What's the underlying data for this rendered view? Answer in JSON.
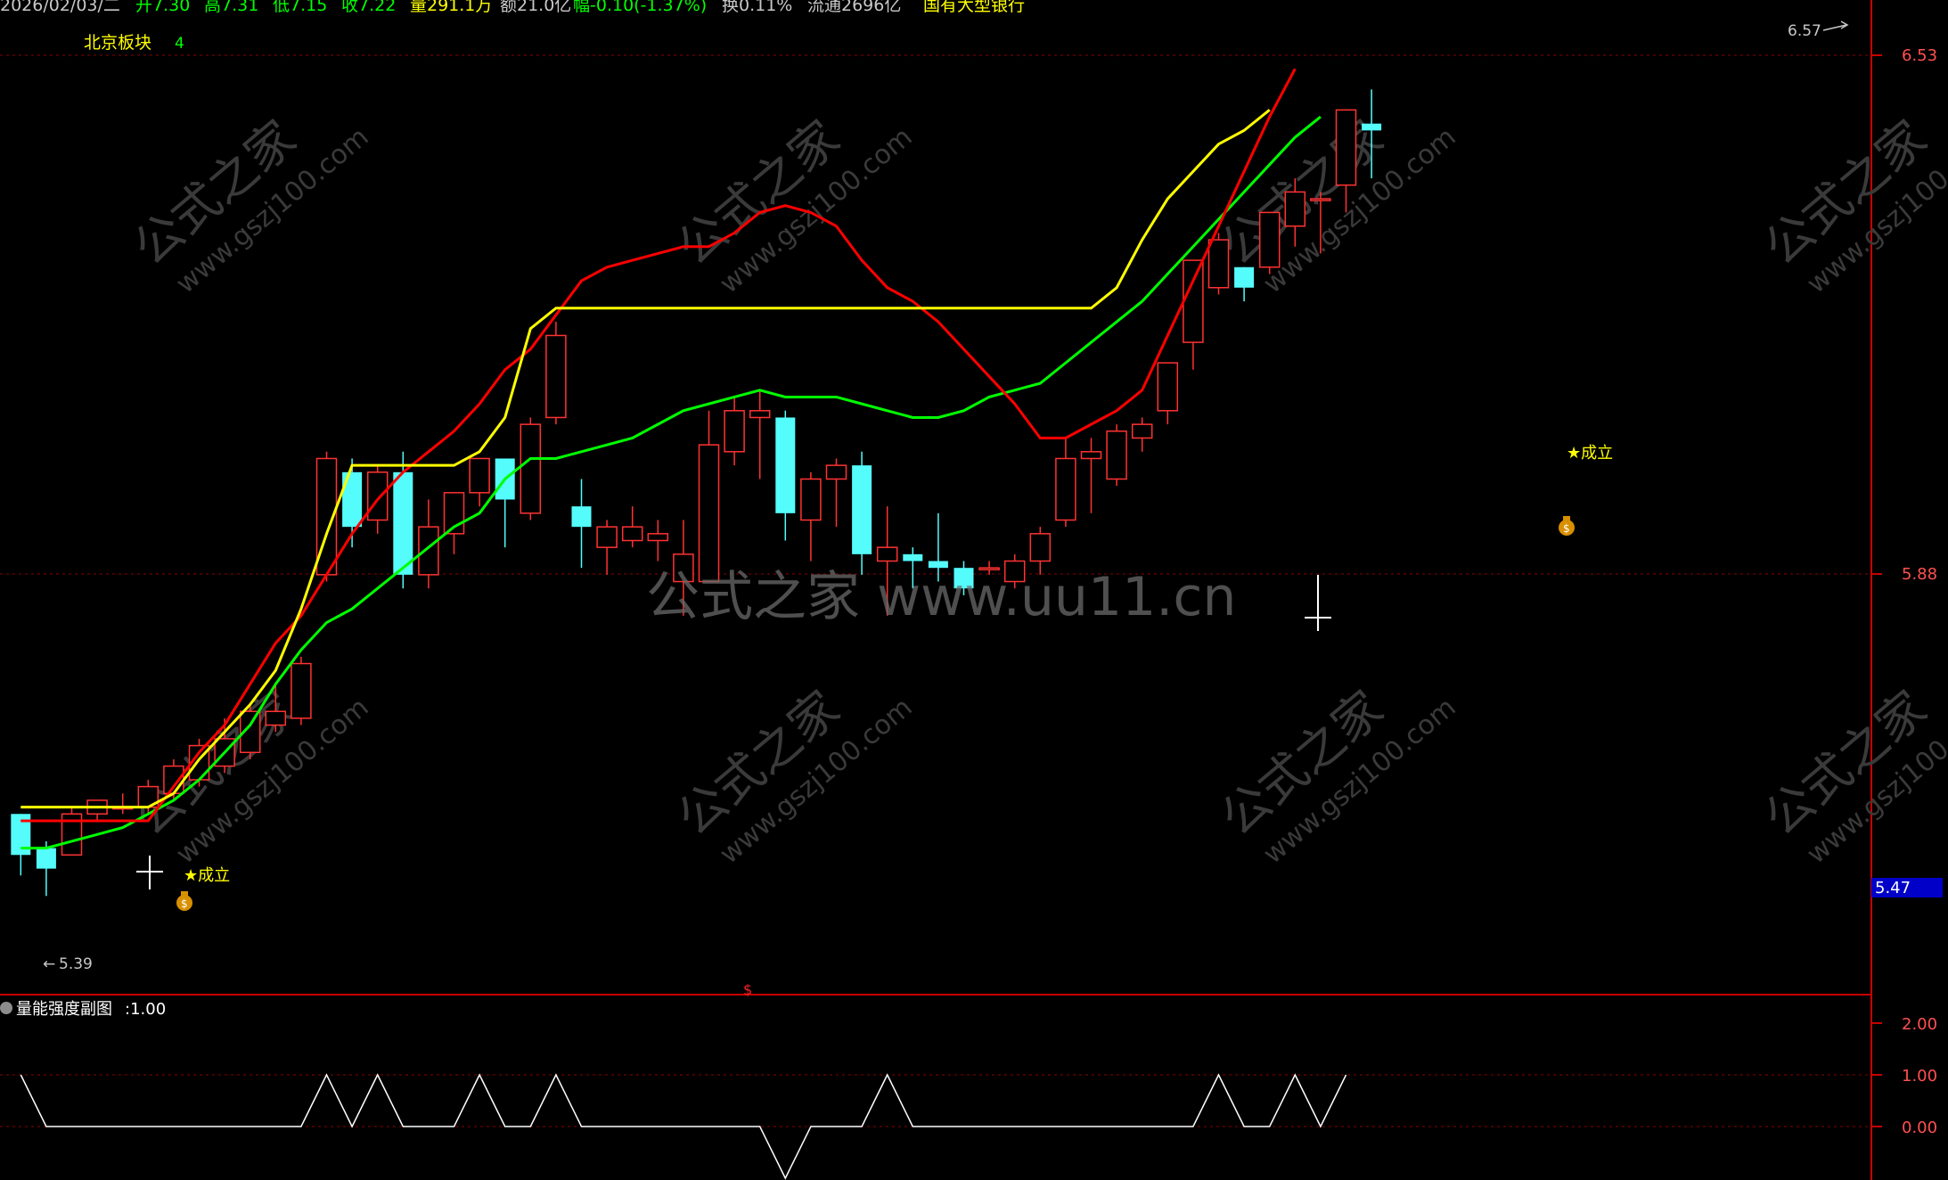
{
  "colors": {
    "background": "#000000",
    "up_candle": "#ff3232",
    "down_candle": "#54fcfc",
    "ma_red": "#ff0000",
    "ma_yellow": "#ffff00",
    "ma_green": "#00ff00",
    "grid_dotted": "#8b0000",
    "axis_red": "#c80000",
    "sub_line": "#ffffff",
    "latest_price_box": "#0000c8"
  },
  "header": {
    "date": "2026/02/03/二",
    "open": "开7.30",
    "high": "高7.31",
    "low": "低7.15",
    "close": "收7.22",
    "volume": "量291.1万",
    "amount": "额21.0亿",
    "change": "幅-0.10(-1.37%)",
    "turnover": "换0.11%",
    "float": "流通2696亿",
    "sector": "国有大型银行",
    "block_name": "北京板块",
    "block_count": "4"
  },
  "main_panel": {
    "price_axis_labels": [
      "6.53",
      "5.88"
    ],
    "latest_price_label": "5.47",
    "high_marker": "6.57",
    "low_marker": "5.39",
    "signals": [
      "★成立",
      "★成立"
    ],
    "bottom_marker": "$",
    "watermark_brand": "公式之家",
    "watermark_site": "www.gszj100.com",
    "watermark_center": "公式之家 www.uu11.cn"
  },
  "sub_panel": {
    "title": "量能强度副图",
    "value": ":1.00",
    "axis_labels": [
      "2.00",
      "1.00",
      "0.00"
    ]
  },
  "chart_data": {
    "type": "candlestick",
    "price_ylim": [
      5.26,
      6.62
    ],
    "candles": [
      {
        "o": 5.51,
        "h": 5.51,
        "l": 5.42,
        "c": 5.45
      },
      {
        "o": 5.46,
        "h": 5.47,
        "l": 5.39,
        "c": 5.43
      },
      {
        "o": 5.45,
        "h": 5.52,
        "l": 5.45,
        "c": 5.51
      },
      {
        "o": 5.51,
        "h": 5.53,
        "l": 5.5,
        "c": 5.53
      },
      {
        "o": 5.52,
        "h": 5.54,
        "l": 5.51,
        "c": 5.52
      },
      {
        "o": 5.52,
        "h": 5.56,
        "l": 5.51,
        "c": 5.55
      },
      {
        "o": 5.54,
        "h": 5.59,
        "l": 5.53,
        "c": 5.58
      },
      {
        "o": 5.56,
        "h": 5.62,
        "l": 5.55,
        "c": 5.61
      },
      {
        "o": 5.58,
        "h": 5.65,
        "l": 5.57,
        "c": 5.62
      },
      {
        "o": 5.6,
        "h": 5.67,
        "l": 5.59,
        "c": 5.66
      },
      {
        "o": 5.64,
        "h": 5.7,
        "l": 5.63,
        "c": 5.66
      },
      {
        "o": 5.65,
        "h": 5.74,
        "l": 5.64,
        "c": 5.73
      },
      {
        "o": 5.86,
        "h": 6.04,
        "l": 5.85,
        "c": 6.03
      },
      {
        "o": 6.01,
        "h": 6.03,
        "l": 5.9,
        "c": 5.93
      },
      {
        "o": 5.94,
        "h": 6.02,
        "l": 5.92,
        "c": 6.01
      },
      {
        "o": 6.01,
        "h": 6.04,
        "l": 5.84,
        "c": 5.86
      },
      {
        "o": 5.86,
        "h": 5.97,
        "l": 5.84,
        "c": 5.93
      },
      {
        "o": 5.92,
        "h": 5.98,
        "l": 5.89,
        "c": 5.98
      },
      {
        "o": 5.98,
        "h": 6.02,
        "l": 5.96,
        "c": 6.03
      },
      {
        "o": 6.03,
        "h": 6.03,
        "l": 5.9,
        "c": 5.97
      },
      {
        "o": 5.95,
        "h": 6.09,
        "l": 5.94,
        "c": 6.08
      },
      {
        "o": 6.09,
        "h": 6.23,
        "l": 6.08,
        "c": 6.21
      },
      {
        "o": 5.96,
        "h": 6.0,
        "l": 5.87,
        "c": 5.93
      },
      {
        "o": 5.9,
        "h": 5.94,
        "l": 5.86,
        "c": 5.93
      },
      {
        "o": 5.91,
        "h": 5.96,
        "l": 5.9,
        "c": 5.93
      },
      {
        "o": 5.91,
        "h": 5.94,
        "l": 5.88,
        "c": 5.92
      },
      {
        "o": 5.85,
        "h": 5.94,
        "l": 5.8,
        "c": 5.89
      },
      {
        "o": 5.85,
        "h": 6.1,
        "l": 5.85,
        "c": 6.05
      },
      {
        "o": 6.04,
        "h": 6.12,
        "l": 6.02,
        "c": 6.1
      },
      {
        "o": 6.09,
        "h": 6.13,
        "l": 6.0,
        "c": 6.1
      },
      {
        "o": 6.09,
        "h": 6.1,
        "l": 5.91,
        "c": 5.95
      },
      {
        "o": 5.94,
        "h": 6.01,
        "l": 5.88,
        "c": 6.0
      },
      {
        "o": 6.0,
        "h": 6.03,
        "l": 5.93,
        "c": 6.02
      },
      {
        "o": 6.02,
        "h": 6.04,
        "l": 5.86,
        "c": 5.89
      },
      {
        "o": 5.88,
        "h": 5.96,
        "l": 5.8,
        "c": 5.9
      },
      {
        "o": 5.89,
        "h": 5.9,
        "l": 5.84,
        "c": 5.88
      },
      {
        "o": 5.88,
        "h": 5.95,
        "l": 5.85,
        "c": 5.87
      },
      {
        "o": 5.87,
        "h": 5.88,
        "l": 5.83,
        "c": 5.84
      },
      {
        "o": 5.87,
        "h": 5.88,
        "l": 5.86,
        "c": 5.87
      },
      {
        "o": 5.85,
        "h": 5.89,
        "l": 5.84,
        "c": 5.88
      },
      {
        "o": 5.88,
        "h": 5.93,
        "l": 5.86,
        "c": 5.92
      },
      {
        "o": 5.94,
        "h": 6.06,
        "l": 5.93,
        "c": 6.03
      },
      {
        "o": 6.03,
        "h": 6.06,
        "l": 5.95,
        "c": 6.04
      },
      {
        "o": 6.0,
        "h": 6.08,
        "l": 5.99,
        "c": 6.07
      },
      {
        "o": 6.06,
        "h": 6.09,
        "l": 6.04,
        "c": 6.08
      },
      {
        "o": 6.1,
        "h": 6.17,
        "l": 6.08,
        "c": 6.17
      },
      {
        "o": 6.2,
        "h": 6.32,
        "l": 6.16,
        "c": 6.32
      },
      {
        "o": 6.28,
        "h": 6.36,
        "l": 6.27,
        "c": 6.35
      },
      {
        "o": 6.31,
        "h": 6.31,
        "l": 6.26,
        "c": 6.28
      },
      {
        "o": 6.31,
        "h": 6.39,
        "l": 6.3,
        "c": 6.39
      },
      {
        "o": 6.37,
        "h": 6.44,
        "l": 6.34,
        "c": 6.42
      },
      {
        "o": 6.41,
        "h": 6.42,
        "l": 6.33,
        "c": 6.41
      },
      {
        "o": 6.43,
        "h": 6.52,
        "l": 6.39,
        "c": 6.54
      },
      {
        "o": 6.52,
        "h": 6.57,
        "l": 6.44,
        "c": 6.51
      }
    ],
    "ma_red": [
      5.5,
      5.5,
      5.5,
      5.5,
      5.5,
      5.5,
      5.55,
      5.6,
      5.64,
      5.7,
      5.76,
      5.8,
      5.86,
      5.92,
      5.97,
      6.01,
      6.04,
      6.07,
      6.11,
      6.16,
      6.19,
      6.24,
      6.29,
      6.31,
      6.32,
      6.33,
      6.34,
      6.34,
      6.36,
      6.39,
      6.4,
      6.39,
      6.37,
      6.32,
      6.28,
      6.26,
      6.23,
      6.19,
      6.15,
      6.11,
      6.06,
      6.06,
      6.08,
      6.1,
      6.13,
      6.21,
      6.29,
      6.37,
      6.45,
      6.53,
      6.6
    ],
    "ma_yellow": [
      5.52,
      5.52,
      5.52,
      5.52,
      5.52,
      5.52,
      5.54,
      5.59,
      5.63,
      5.67,
      5.72,
      5.81,
      5.92,
      6.02,
      6.02,
      6.02,
      6.02,
      6.02,
      6.04,
      6.09,
      6.22,
      6.25,
      6.25,
      6.25,
      6.25,
      6.25,
      6.25,
      6.25,
      6.25,
      6.25,
      6.25,
      6.25,
      6.25,
      6.25,
      6.25,
      6.25,
      6.25,
      6.25,
      6.25,
      6.25,
      6.25,
      6.25,
      6.25,
      6.28,
      6.35,
      6.41,
      6.45,
      6.49,
      6.51,
      6.54
    ],
    "ma_green": [
      5.46,
      5.46,
      5.47,
      5.48,
      5.49,
      5.51,
      5.53,
      5.56,
      5.6,
      5.64,
      5.7,
      5.75,
      5.79,
      5.81,
      5.84,
      5.87,
      5.9,
      5.93,
      5.95,
      6.0,
      6.03,
      6.03,
      6.04,
      6.05,
      6.06,
      6.08,
      6.1,
      6.11,
      6.12,
      6.13,
      6.12,
      6.12,
      6.12,
      6.11,
      6.1,
      6.09,
      6.09,
      6.1,
      6.12,
      6.13,
      6.14,
      6.17,
      6.2,
      6.23,
      6.26,
      6.3,
      6.34,
      6.38,
      6.42,
      6.46,
      6.5,
      6.53
    ],
    "sub_series": [
      1,
      0,
      0,
      0,
      0,
      0,
      0,
      0,
      0,
      0,
      0,
      0,
      1,
      0,
      1,
      0,
      0,
      0,
      1,
      0,
      0,
      1,
      0,
      0,
      0,
      0,
      0,
      0,
      0,
      0,
      -1,
      0,
      0,
      0,
      1,
      0,
      0,
      0,
      0,
      0,
      0,
      0,
      0,
      0,
      0,
      0,
      0,
      1,
      0,
      0,
      1,
      0,
      1
    ],
    "sub_ylim": [
      -1,
      2
    ]
  }
}
